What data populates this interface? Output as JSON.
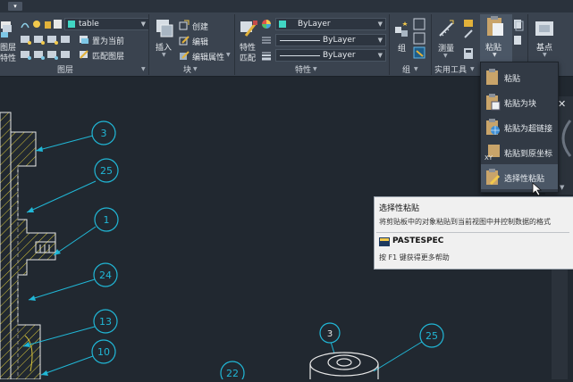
{
  "quick_access": {
    "menu_glyph": "▾"
  },
  "ribbon": {
    "layers": {
      "properties_label_line1": "图层",
      "properties_label_line2": "特性",
      "layer_combo_value": "table",
      "match_layer_label": "置为当前",
      "layer_match_label": "匹配图层",
      "group_label": "图层"
    },
    "block": {
      "insert_label": "插入",
      "create_label": "创建",
      "edit_label": "编辑",
      "edit_attributes_label": "编辑属性",
      "group_label": "块"
    },
    "properties": {
      "match_label_line1": "特性",
      "match_label_line2": "匹配",
      "color_value": "ByLayer",
      "linetype_value": "ByLayer",
      "lineweight_value": "ByLayer",
      "group_label": "特性"
    },
    "groups": {
      "group_label": "组",
      "tool_label": "组"
    },
    "utilities": {
      "measure_label": "测量",
      "group_label": "实用工具"
    },
    "clipboard": {
      "paste_label": "粘贴"
    },
    "view": {
      "base_label": "基点"
    }
  },
  "paste_menu": {
    "items": [
      {
        "label": "粘贴"
      },
      {
        "label": "粘贴为块"
      },
      {
        "label": "粘贴为超链接"
      },
      {
        "label": "粘贴到原坐标"
      },
      {
        "label": "选择性粘贴"
      }
    ]
  },
  "tooltip": {
    "title": "选择性粘贴",
    "description": "将剪贴板中的对象粘贴到当前视图中并控制数据的格式",
    "command": "PASTESPEC",
    "help": "按 F1 键获得更多帮助"
  },
  "drawing": {
    "balloons": [
      "3",
      "25",
      "1",
      "24",
      "13",
      "10",
      "3",
      "25",
      "22"
    ]
  },
  "colors": {
    "accent_cyan": "#21b7d6",
    "hatch_yellow": "#d7c43a",
    "canvas": "#212830"
  }
}
